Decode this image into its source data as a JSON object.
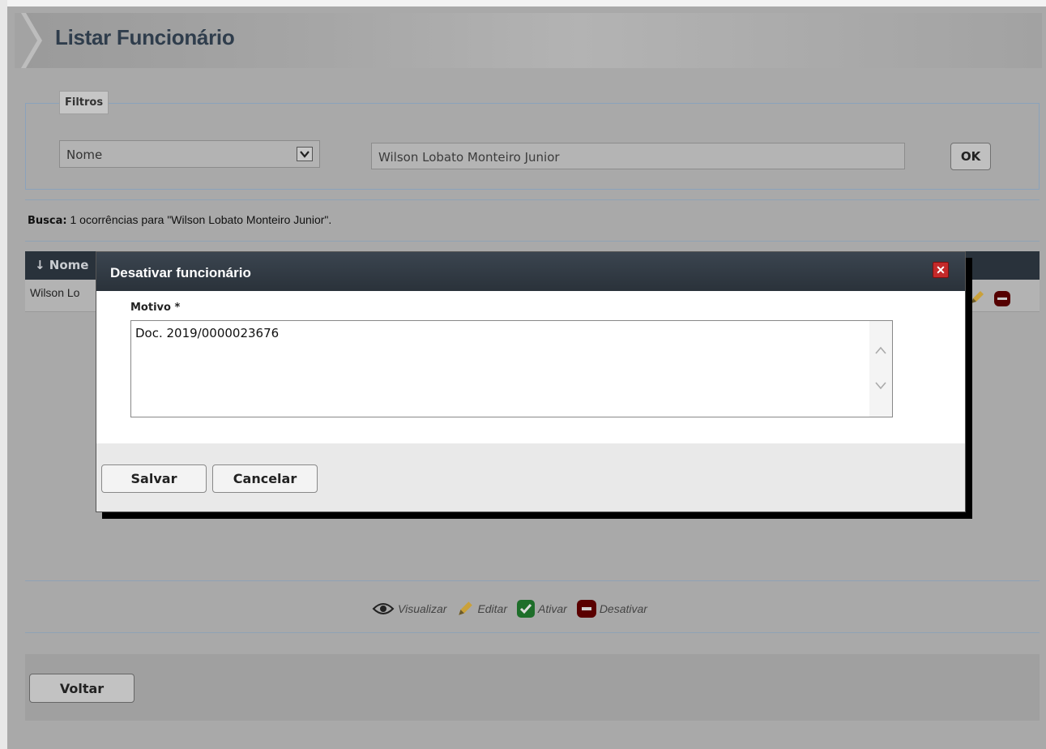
{
  "header": {
    "title": "Listar Funcionário"
  },
  "filters": {
    "legend": "Filtros",
    "field_select": {
      "selected": "Nome"
    },
    "search_input": {
      "value": "Wilson Lobato Monteiro Junior"
    },
    "ok_label": "OK"
  },
  "search_result": {
    "label": "Busca:",
    "text": "1 ocorrências para \"Wilson Lobato Monteiro Junior\"."
  },
  "table": {
    "columns": [
      "↓ Nome"
    ],
    "rows": [
      {
        "nome": "Wilson Lo"
      }
    ]
  },
  "legend": {
    "items": [
      {
        "label": "Visualizar",
        "icon": "eye-icon"
      },
      {
        "label": "Editar",
        "icon": "pencil-icon"
      },
      {
        "label": "Ativar",
        "icon": "check-icon",
        "color": "#1e6e2a"
      },
      {
        "label": "Desativar",
        "icon": "minus-icon",
        "color": "#5a0000"
      }
    ]
  },
  "footer": {
    "back_label": "Voltar"
  },
  "modal": {
    "title": "Desativar funcionário",
    "close_icon": "close-icon",
    "field_label": "Motivo *",
    "field_value": "Doc. 2019/0000023676",
    "save_label": "Salvar",
    "cancel_label": "Cancelar"
  }
}
